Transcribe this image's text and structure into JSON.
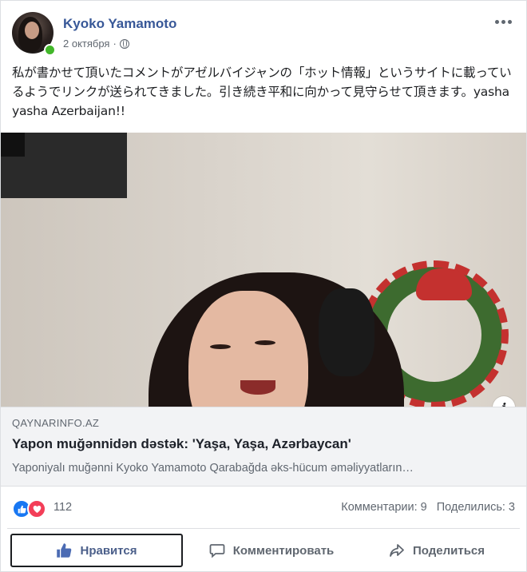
{
  "post": {
    "author": "Kyoko Yamamoto",
    "date": "2 октября",
    "separator": "·",
    "text": "私が書かせて頂いたコメントがアゼルバイジャンの「ホット情報」というサイトに載っているようでリンクが送られてきました。引き続き平和に向かって見守らせて頂きます。yasha yasha Azerbaijan!!"
  },
  "link": {
    "domain": "QAYNARINFO.AZ",
    "title": "Yapon muğənnidən dəstək: 'Yaşa, Yaşa, Azərbaycan'",
    "description": "Yaponiyalı muğənni Kyoko Yamamoto Qarabağda əks-hücum əməliyyatların…"
  },
  "reactions": {
    "count": "112",
    "comments": "Комментарии: 9",
    "shares": "Поделились: 3"
  },
  "actions": {
    "like": "Нравится",
    "comment": "Комментировать",
    "share": "Поделиться"
  },
  "icons": {
    "info": "i",
    "like_badge": "thumbs-up-icon",
    "love_badge": "heart-icon"
  },
  "colors": {
    "author": "#385898",
    "like_blue": "#1877f2",
    "love_red": "#f33e58",
    "online": "#42b72a"
  }
}
